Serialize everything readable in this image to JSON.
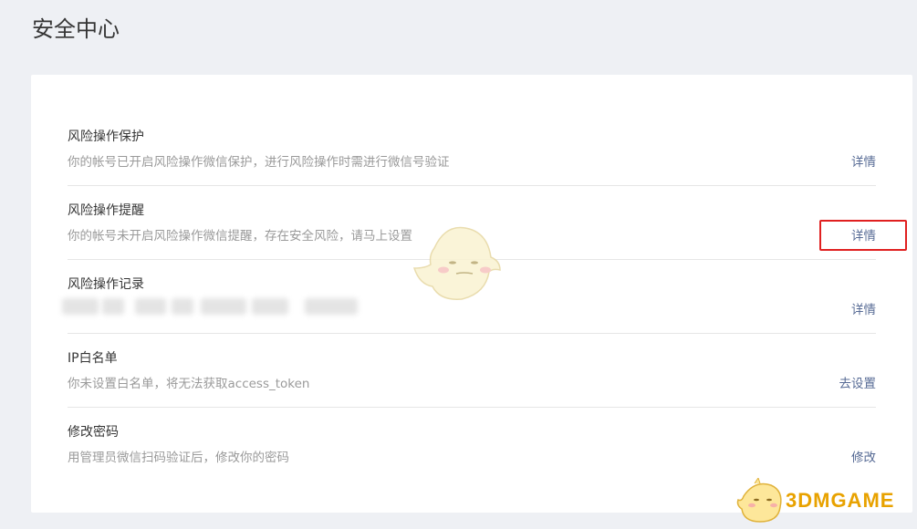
{
  "page": {
    "title": "安全中心"
  },
  "items": [
    {
      "title": "风险操作保护",
      "desc": "你的帐号已开启风险操作微信保护，进行风险操作时需进行微信号验证",
      "action": "详情"
    },
    {
      "title": "风险操作提醒",
      "desc": "你的帐号未开启风险操作微信提醒，存在安全风险，请马上设置",
      "action": "详情"
    },
    {
      "title": "风险操作记录",
      "desc": "",
      "action": "详情"
    },
    {
      "title": "IP白名单",
      "desc": "你未设置白名单，将无法获取access_token",
      "action": "去设置"
    },
    {
      "title": "修改密码",
      "desc": "用管理员微信扫码验证后，修改你的密码",
      "action": "修改"
    }
  ],
  "watermark": {
    "text": "3DMGAME"
  },
  "colors": {
    "link": "#576b95",
    "highlight": "#e02020",
    "background": "#eef0f4"
  }
}
